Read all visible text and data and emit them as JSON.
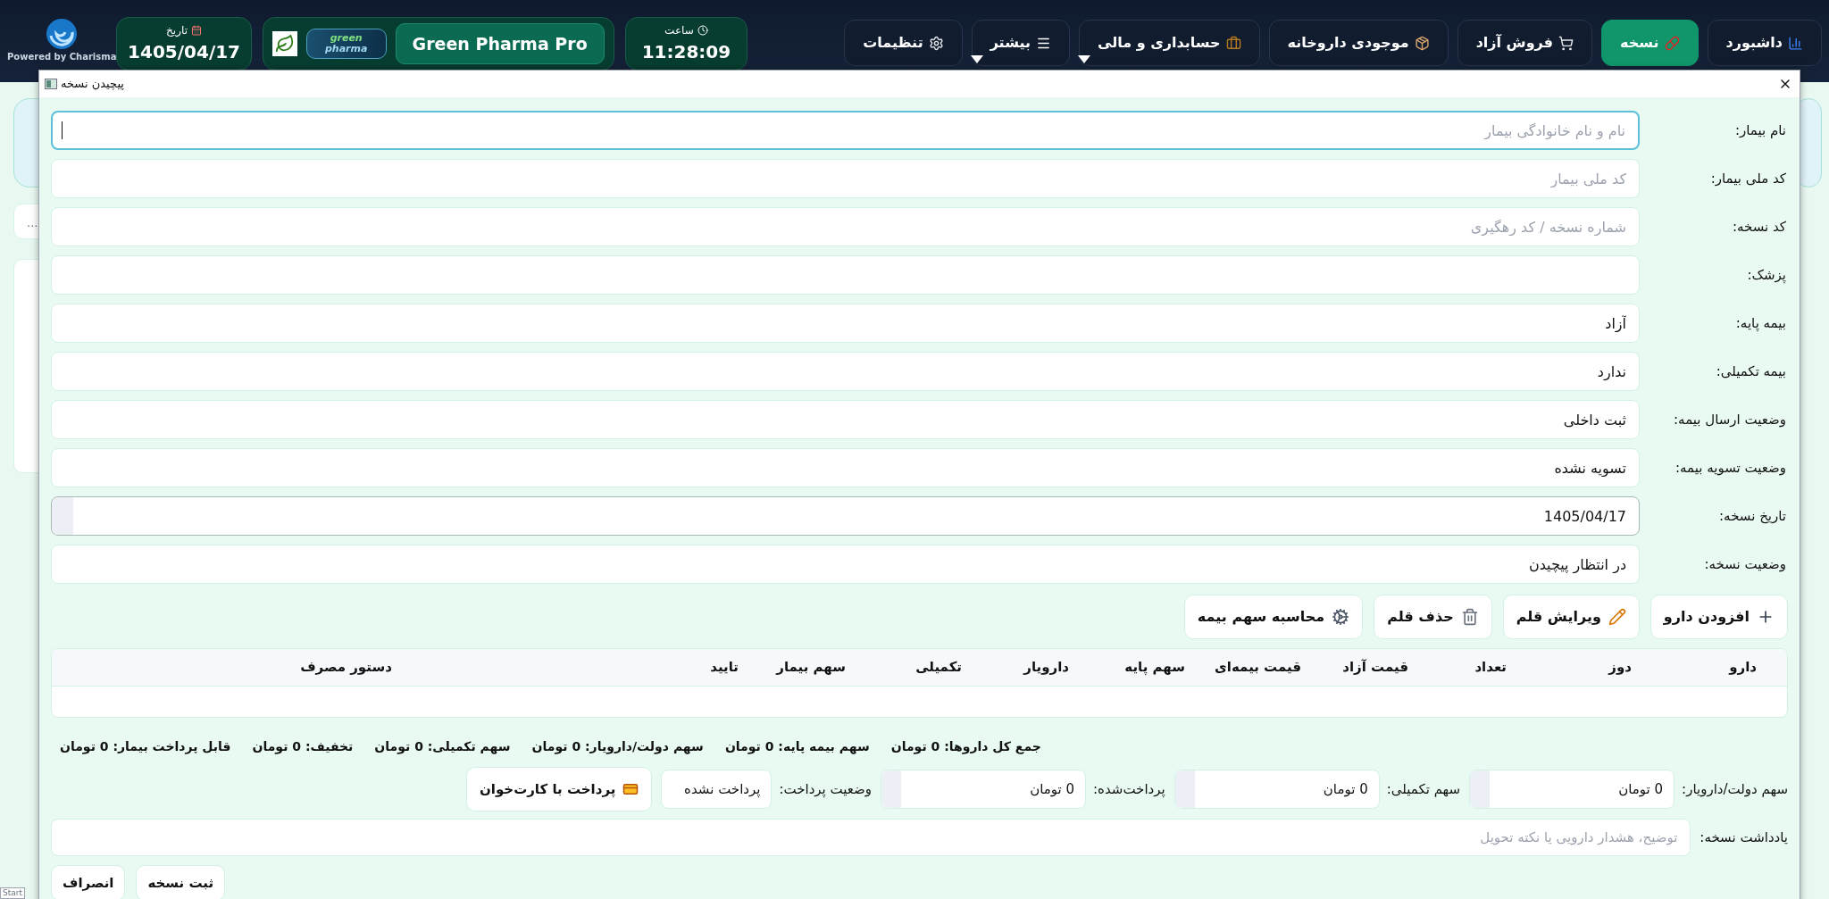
{
  "topbar": {
    "powered_by": "Powered by Charisma",
    "nav": [
      {
        "label": "داشبورد",
        "selected": false,
        "dropdown": false
      },
      {
        "label": "نسخه",
        "selected": true,
        "dropdown": false
      },
      {
        "label": "فروش آزاد",
        "selected": false,
        "dropdown": false
      },
      {
        "label": "موجودی داروخانه",
        "selected": false,
        "dropdown": false
      },
      {
        "label": "حسابداری و مالی",
        "selected": false,
        "dropdown": true
      },
      {
        "label": "بیشتر",
        "selected": false,
        "dropdown": true
      },
      {
        "label": "تنظیمات",
        "selected": false,
        "dropdown": false
      }
    ],
    "clock": {
      "label": "ساعت",
      "value": "11:28:09"
    },
    "brand": {
      "logo_lines": [
        "green",
        "pharma"
      ],
      "button": "Green Pharma Pro"
    },
    "date": {
      "label": "تاریخ",
      "value": "1405/04/17"
    }
  },
  "background": {
    "ellipsis": "..."
  },
  "dialog": {
    "title": "پیچیدن نسخه",
    "fields": [
      {
        "label": "نام بیمار:",
        "placeholder": "نام و نام خانوادگی بیمار",
        "focused": true,
        "kind": "text"
      },
      {
        "label": "کد ملی بیمار:",
        "placeholder": "کد ملی بیمار",
        "focused": false,
        "kind": "text"
      },
      {
        "label": "کد نسخه:",
        "placeholder": "شماره نسخه / کد رهگیری",
        "focused": false,
        "kind": "text"
      },
      {
        "label": "پزشک:",
        "focused": false,
        "kind": "text"
      },
      {
        "label": "بیمه پایه:",
        "value": "آزاد",
        "focused": false,
        "kind": "text"
      },
      {
        "label": "بیمه تکمیلی:",
        "value": "ندارد",
        "focused": false,
        "kind": "text"
      },
      {
        "label": "وضعیت ارسال بیمه:",
        "value": "ثبت داخلی",
        "focused": false,
        "kind": "text"
      },
      {
        "label": "وضعیت تسویه بیمه:",
        "value": "تسویه نشده",
        "focused": false,
        "kind": "text"
      },
      {
        "label": "تاریخ نسخه:",
        "value": "1405/04/17",
        "focused": false,
        "kind": "date"
      },
      {
        "label": "وضعیت نسخه:",
        "value": "در انتظار پیچیدن",
        "focused": false,
        "kind": "text"
      }
    ],
    "toolbar": [
      "افزودن دارو",
      "ویرایش قلم",
      "حذف قلم",
      "محاسبه سهم بیمه"
    ],
    "table": {
      "columns": [
        "دارو",
        "دوز",
        "تعداد",
        "قیمت آزاد",
        "قیمت بیمه‌ای",
        "سهم پایه",
        "دارویار",
        "تکمیلی",
        "سهم بیمار",
        "تایید",
        "دستور مصرف"
      ]
    },
    "summary": [
      "جمع کل داروها: 0 تومان",
      "سهم بیمه پایه: 0 تومان",
      "سهم دولت/دارویار: 0 تومان",
      "سهم تکمیلی: 0 تومان",
      "تخفیف: 0 تومان",
      "قابل پرداخت بیمار: 0 تومان"
    ],
    "payment": [
      {
        "label": "سهم دولت/دارویار:",
        "value": "0 تومان",
        "kind": "amount"
      },
      {
        "label": "سهم تکمیلی:",
        "value": "0 تومان",
        "kind": "amount"
      },
      {
        "label": "پرداخت‌شده:",
        "value": "0 تومان",
        "kind": "amount"
      },
      {
        "label": "وضعیت پرداخت:",
        "value": "پرداخت نشده",
        "kind": "status"
      }
    ],
    "pay_button": "پرداخت با کارت‌خوان",
    "note": {
      "label": "یادداشت نسخه:",
      "placeholder": "توضیح، هشدار دارویی یا نکته تحویل"
    },
    "actions": [
      "ثبت نسخه",
      "انصراف"
    ]
  },
  "taskbar": {
    "start": "Start"
  }
}
